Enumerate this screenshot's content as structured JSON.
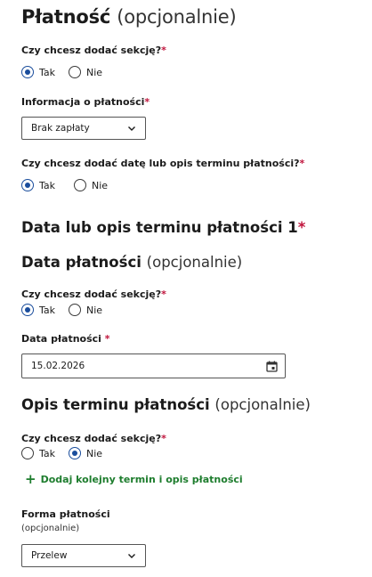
{
  "payment": {
    "title": "Płatność",
    "optional": "(opcjonalnie)",
    "add_section_q": "Czy chcesz dodać sekcję?",
    "req_mark": "*",
    "yes": "Tak",
    "no": "Nie",
    "info_label": "Informacja o płatności",
    "info_value": "Brak zapłaty",
    "add_date_q": "Czy chcesz dodać datę lub opis terminu płatności?"
  },
  "term": {
    "title": "Data lub opis terminu płatności 1"
  },
  "pay_date": {
    "title": "Data płatności",
    "optional": "(opcjonalnie)",
    "add_section_q": "Czy chcesz dodać sekcję?",
    "field_label": "Data płatności",
    "value": "15.02.2026"
  },
  "term_desc": {
    "title": "Opis terminu płatności",
    "optional": "(opcjonalnie)",
    "add_section_q": "Czy chcesz dodać sekcję?"
  },
  "add_term_link": "Dodaj kolejny termin i opis płatności",
  "pay_form": {
    "label": "Forma płatności",
    "optional": "(opcjonalnie)",
    "value": "Przelew"
  },
  "colors": {
    "radio_selected": "#1a4d9c",
    "required": "#c0143c",
    "link_green": "#1e7d2e"
  }
}
